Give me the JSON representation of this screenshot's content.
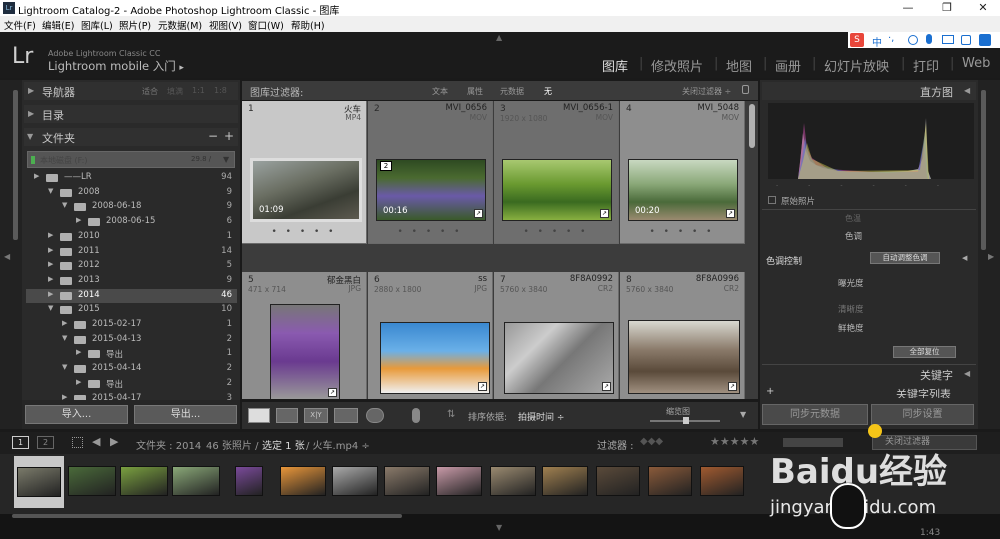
{
  "window": {
    "title": "Lightroom Catalog-2 - Adobe Photoshop Lightroom Classic - 图库",
    "app_icon": "Lr",
    "controls": [
      "—",
      "❐",
      "✕"
    ]
  },
  "menu": [
    "文件(F)",
    "编辑(E)",
    "图库(L)",
    "照片(P)",
    "元数据(M)",
    "视图(V)",
    "窗口(W)",
    "帮助(H)"
  ],
  "idplate": {
    "logo": "Lr",
    "line1": "Adobe Lightroom Classic CC",
    "line2": "Lightroom mobile 入门",
    "arrow": "▸"
  },
  "modules": [
    "图库",
    "修改照片",
    "地图",
    "画册",
    "幻灯片放映",
    "打印",
    "Web"
  ],
  "ime": {
    "sogou": "S",
    "zh": "中",
    "comma": "·,"
  },
  "left": {
    "navigator": "导航器",
    "nav_opts": [
      "适合",
      "填满",
      "1:1",
      "1:8"
    ],
    "catalog": "目录",
    "folders": "文件夹",
    "minus": "−",
    "plus": "+",
    "volume": {
      "name": "本地磁盘 (F:)",
      "size": "29.8 / "
    },
    "rows": [
      {
        "name": "——LR",
        "count": "94"
      },
      {
        "name": "2008",
        "count": "9"
      },
      {
        "name": "2008-06-18",
        "count": "9"
      },
      {
        "name": "2008-06-15",
        "count": "6"
      },
      {
        "name": "2010",
        "count": "1"
      },
      {
        "name": "2011",
        "count": "14"
      },
      {
        "name": "2012",
        "count": "5"
      },
      {
        "name": "2013",
        "count": "9"
      },
      {
        "name": "2014",
        "count": "46"
      },
      {
        "name": "2015",
        "count": "10"
      },
      {
        "name": "2015-02-17",
        "count": "1"
      },
      {
        "name": "2015-04-13",
        "count": "2"
      },
      {
        "name": "导出",
        "count": "1"
      },
      {
        "name": "2015-04-14",
        "count": "2"
      },
      {
        "name": "导出",
        "count": "2"
      },
      {
        "name": "2015-04-17",
        "count": "3"
      }
    ],
    "import": "导入...",
    "export": "导出..."
  },
  "filter": {
    "label": "图库过滤器:",
    "opts": [
      "文本",
      "属性",
      "元数据",
      "无"
    ],
    "preset": "关闭过滤器 ÷",
    "lock": "🔒"
  },
  "cells": [
    {
      "n": "1",
      "file": "火车",
      "ext": "MP4",
      "dim": "",
      "dur": "01:09"
    },
    {
      "n": "2",
      "file": "MVI_0656",
      "ext": "MOV",
      "dim": "",
      "dur": "00:16",
      "stack": "2"
    },
    {
      "n": "3",
      "file": "MVI_0656-1",
      "ext": "MOV",
      "dim": "1920 x 1080",
      "dur": ""
    },
    {
      "n": "4",
      "file": "MVI_5048",
      "ext": "MOV",
      "dim": "",
      "dur": "00:20"
    },
    {
      "n": "5",
      "file": "郁金黑白",
      "ext": "JPG",
      "dim": "471 x 714"
    },
    {
      "n": "6",
      "file": "ss",
      "ext": "JPG",
      "dim": "2880 x 1800"
    },
    {
      "n": "7",
      "file": "8F8A0992",
      "ext": "CR2",
      "dim": "5760 x 3840"
    },
    {
      "n": "8",
      "file": "8F8A0996",
      "ext": "CR2",
      "dim": "5760 x 3840"
    }
  ],
  "toolbar": {
    "sort_label": "排序依据:",
    "sort_value": "拍摄时间 ÷",
    "thumb_label": "缩览图"
  },
  "right": {
    "histogram": "直方图",
    "original": "原始照片",
    "partial": "色温",
    "tone_label": "色调",
    "tone_control": "色调控制",
    "auto": "自动调整色调",
    "exposure": "曝光度",
    "clarity": "清晰度",
    "vibrance": "鲜艳度",
    "reset": "全部复位",
    "keywords": "关键字",
    "keyword_list": "关键字列表",
    "sync_meta": "同步元数据",
    "sync_settings": "同步设置"
  },
  "secondary": {
    "pages": [
      "1",
      "2"
    ],
    "path": "文件夹 : 2014",
    "count": "46 张照片 /",
    "selected": "选定 1 张",
    "file": "/ 火车.mp4 ÷",
    "filter_label": "过滤器 :",
    "stars": "★★★★★",
    "filter_value": "关闭过滤器"
  },
  "watermark": {
    "text": "Baidu经验",
    "url": "jingyan.baidu.com"
  },
  "clock": "1:43"
}
